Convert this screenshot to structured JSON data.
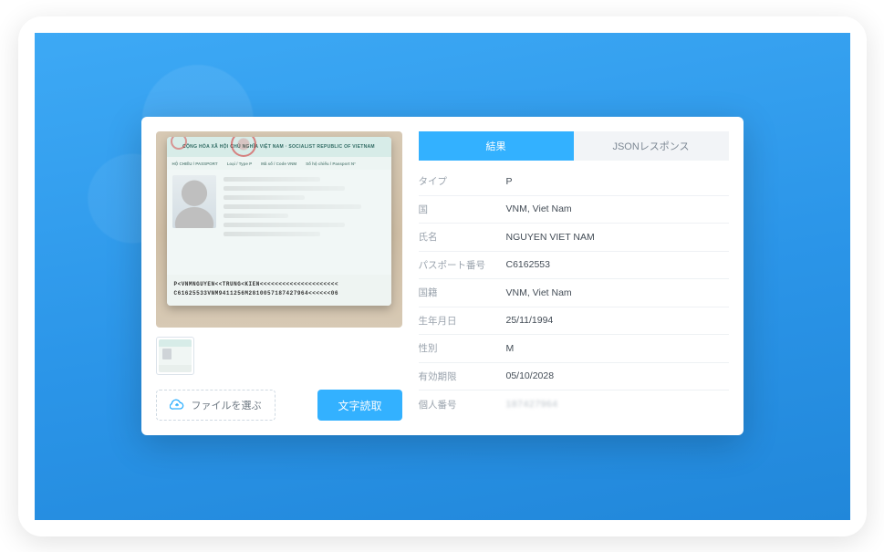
{
  "passport_preview": {
    "header_text": "CỘNG HÒA XÃ HỘI CHỦ NGHĨA VIỆT NAM · SOCIALIST REPUBLIC OF VIETNAM",
    "subheader": {
      "doc": "HỘ CHIẾU / PASSPORT",
      "type": "Loại / Type  P",
      "code": "Mã số / Code  VNM",
      "num": "Số hộ chiếu / Passport N°"
    },
    "mrz_line1": "P<VNMNGUYEN<<TRUNG<KIEN<<<<<<<<<<<<<<<<<<<<<",
    "mrz_line2": "C61625533VNM9411256M2810057187427964<<<<<<06"
  },
  "buttons": {
    "choose_file": "ファイルを選ぶ",
    "ocr": "文字読取"
  },
  "tabs": {
    "result": "結果",
    "json": "JSONレスポンス"
  },
  "fields": [
    {
      "label": "タイプ",
      "value": "P"
    },
    {
      "label": "国",
      "value": "VNM, Viet Nam"
    },
    {
      "label": "氏名",
      "value": "NGUYEN VIET NAM"
    },
    {
      "label": "パスポート番号",
      "value": "C6162553"
    },
    {
      "label": "国籍",
      "value": "VNM, Viet Nam"
    },
    {
      "label": "生年月日",
      "value": "25/11/1994"
    },
    {
      "label": "性別",
      "value": "M"
    },
    {
      "label": "有効期限",
      "value": "05/10/2028"
    },
    {
      "label": "個人番号",
      "value": "187427964",
      "blur": true
    }
  ]
}
